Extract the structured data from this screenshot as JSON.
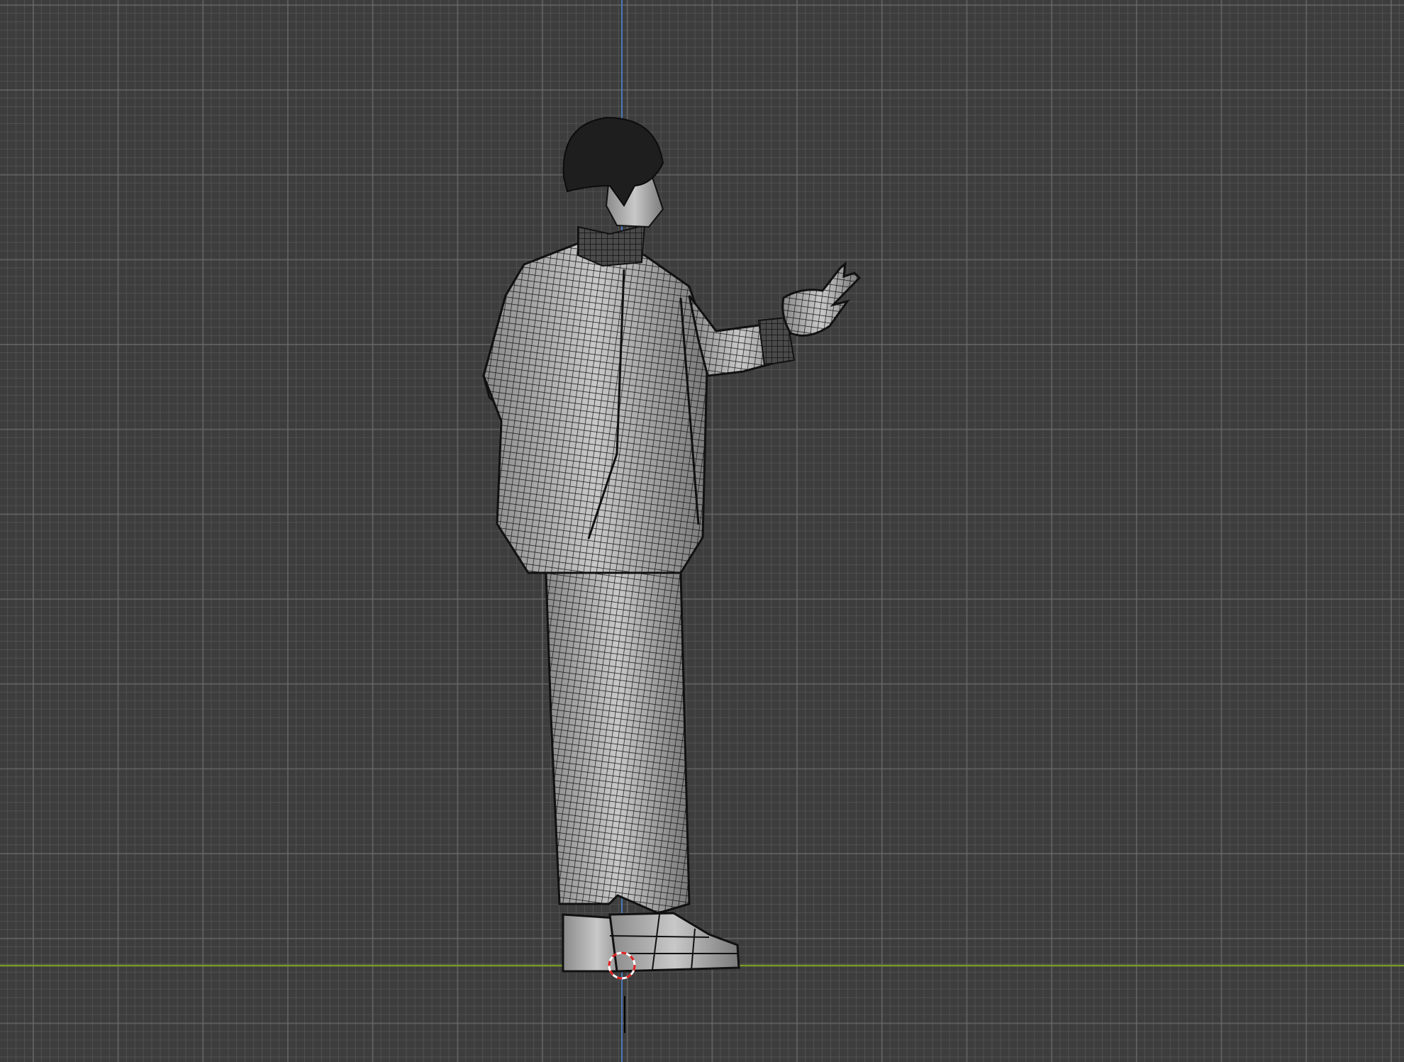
{
  "viewport": {
    "view": "3d-viewport-wireframe-overlay",
    "colors": {
      "background": "#3d3d3d",
      "grid_minor": "#555555",
      "grid_major": "#6e6e6e",
      "axis_z": "#4a78b8",
      "axis_y": "#7a9a2a",
      "cursor_red": "#e02020",
      "mesh_surface": "#b8b8b8",
      "wire": "#1a1a1a"
    }
  }
}
